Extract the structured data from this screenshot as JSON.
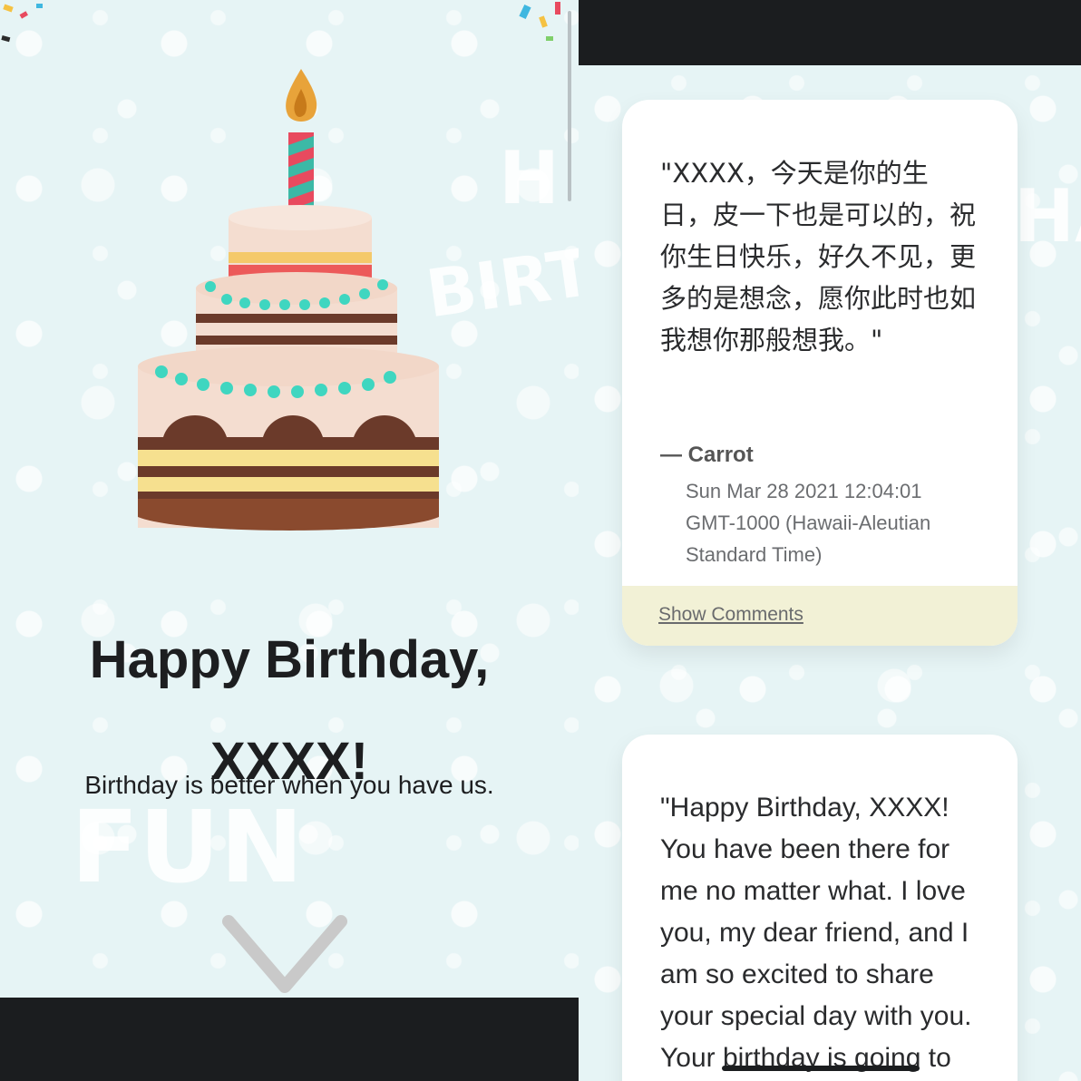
{
  "left_page": {
    "headline_line1": "Happy Birthday,",
    "headline_line2": "XXXX!",
    "subtitle": "Birthday is better when you have us.",
    "background_color": "#e6f4f5",
    "scroll_icon": "chevron-down-icon",
    "illustration": "birthday-cake-with-candle"
  },
  "right_page": {
    "messages": [
      {
        "quote": "\"XXXX，今天是你的生日，皮一下也是可以的，祝你生日快乐，好久不见，更多的是想念，愿你此时也如我想你那般想我。\"",
        "author": "— Carrot",
        "timestamp": "Sun Mar 28 2021 12:04:01 GMT-1000 (Hawaii-Aleutian Standard Time)",
        "show_comments": "Show Comments"
      },
      {
        "quote": "\"Happy Birthday, XXXX! You have been there for me no matter what. I love you, my dear friend, and I am so excited to share your special day with you. Your birthday is going to"
      }
    ]
  },
  "colors": {
    "dark_frame": "#1b1d1f",
    "card_footer": "#f2f1d6",
    "text": "#1d1e20",
    "accent_teal": "#3fd6c0"
  }
}
